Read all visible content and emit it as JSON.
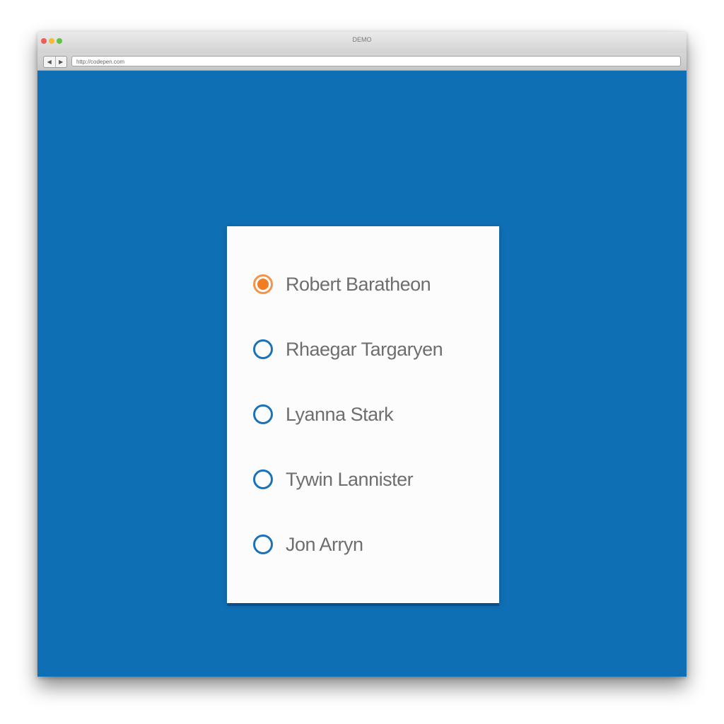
{
  "window": {
    "title": "DEMO",
    "traffic_light_colors": [
      "#ee5d55",
      "#f5b93b",
      "#5fc344"
    ],
    "nav_back_icon": "chevron-left-icon",
    "nav_forward_icon": "chevron-right-icon",
    "back_glyph": "◀",
    "forward_glyph": "▶"
  },
  "address_bar": {
    "url": "http://codepen.com"
  },
  "colors": {
    "background": "#0f6fb4",
    "card": "#fcfcfc",
    "radio_border": "#1b72b8",
    "radio_checked": "#f07d24",
    "label_text": "#6e6e6e"
  },
  "radio_group": {
    "selected_index": 0,
    "options": [
      {
        "label": "Robert Baratheon",
        "checked": true
      },
      {
        "label": "Rhaegar Targaryen",
        "checked": false
      },
      {
        "label": "Lyanna Stark",
        "checked": false
      },
      {
        "label": "Tywin Lannister",
        "checked": false
      },
      {
        "label": "Jon Arryn",
        "checked": false
      }
    ]
  }
}
